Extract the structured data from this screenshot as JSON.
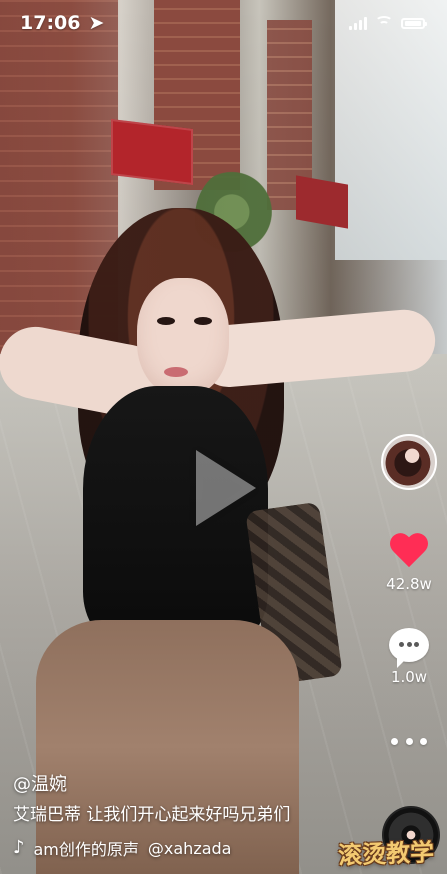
{
  "status_bar": {
    "time": "17:06",
    "location_icon": "location-arrow-icon"
  },
  "video": {
    "play_icon": "play-icon"
  },
  "sidebar": {
    "likes": "42.8w",
    "comments": "1.0w"
  },
  "caption": {
    "username": "@温婉",
    "description": "艾瑞巴蒂 让我们开心起来好吗兄弟们",
    "music": "am创作的原声",
    "music_handle": "@xahzada"
  },
  "watermark": {
    "text": "滚烫教学"
  },
  "colors": {
    "heart": "#ff2d55",
    "watermark": "#f3ca71"
  }
}
